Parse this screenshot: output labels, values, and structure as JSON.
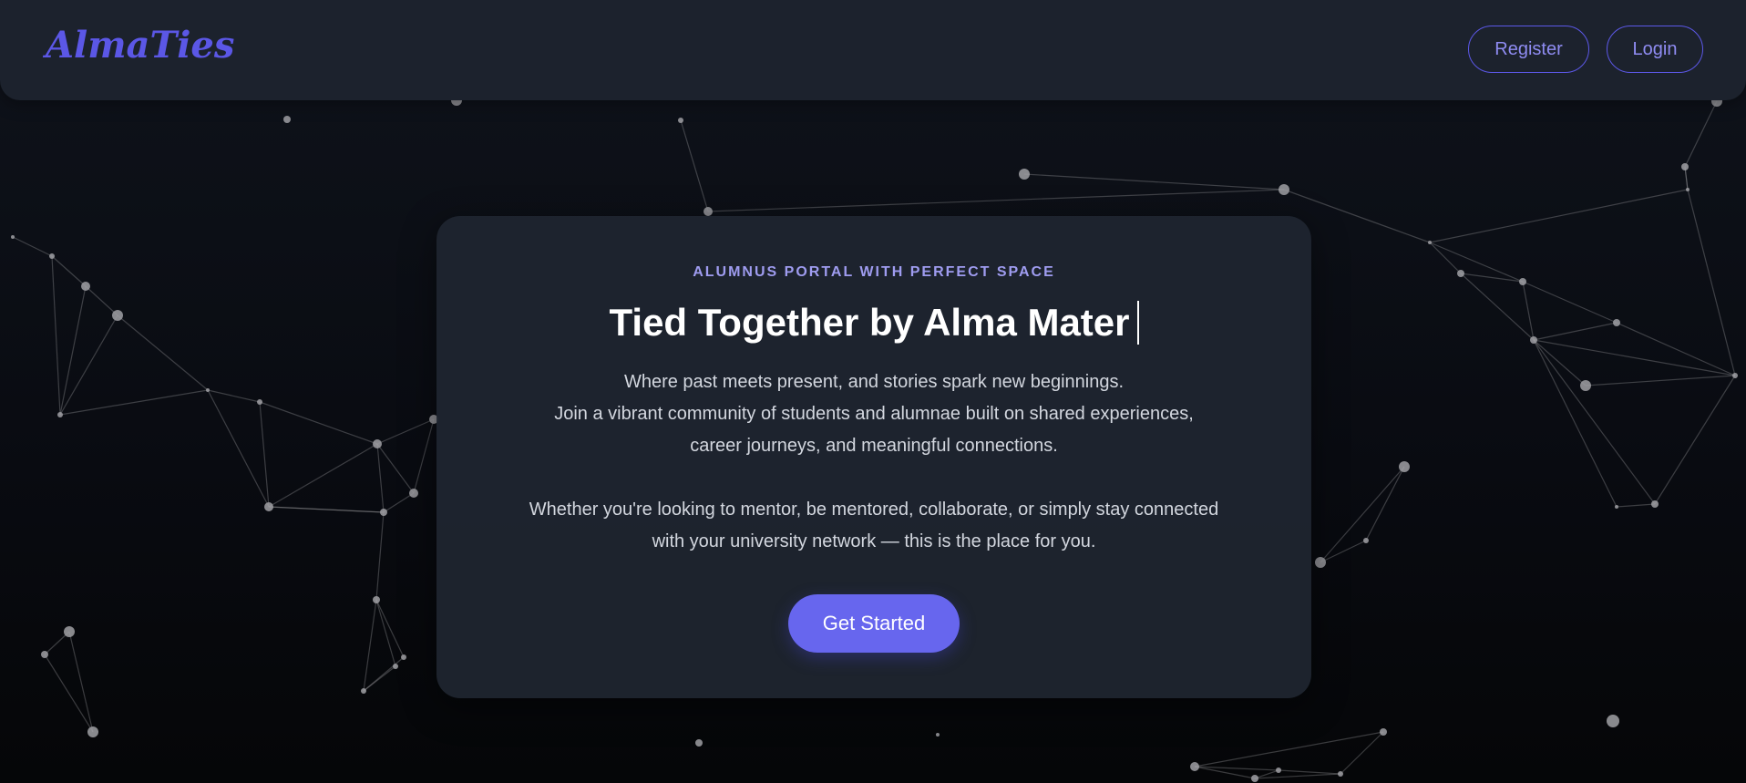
{
  "navbar": {
    "logo_text": "AlmaTies",
    "register_label": "Register",
    "login_label": "Login"
  },
  "hero": {
    "eyebrow": "ALUMNUS PORTAL WITH PERFECT SPACE",
    "title": "Tied Together by Alma Mater",
    "paragraph_lines_1": [
      "Where past meets present, and stories spark new beginnings.",
      "Join a vibrant community of students and alumnae built on shared experiences,",
      "career journeys, and meaningful connections."
    ],
    "paragraph_lines_2": [
      "Whether you're looking to mentor, be mentored, collaborate, or simply stay connected",
      "with your university network — this is the place for you."
    ],
    "cta_label": "Get Started"
  },
  "colors": {
    "accent": "#5b57e6",
    "cta": "#6766ee",
    "background": "#0b0e15",
    "card": "#1f2530"
  }
}
